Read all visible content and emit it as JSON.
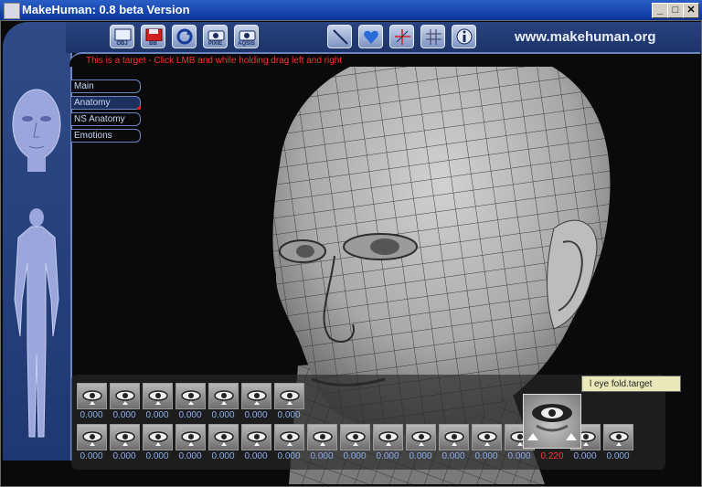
{
  "window": {
    "title": "MakeHuman: 0.8 beta Version",
    "minimize": "_",
    "maximize": "□",
    "close": "✕"
  },
  "toolbar": {
    "buttons": [
      {
        "name": "export-obj",
        "label": "OBJ",
        "icon": "obj-icon"
      },
      {
        "name": "save",
        "label": "BB",
        "icon": "floppy-icon"
      },
      {
        "name": "refresh",
        "label": "",
        "icon": "refresh-icon"
      },
      {
        "name": "render-pixie",
        "label": "PIXIE",
        "icon": "camera-icon"
      },
      {
        "name": "render-aqsis",
        "label": "AQSIS",
        "icon": "camera-icon"
      },
      {
        "name": "tool-line",
        "label": "",
        "icon": "line-icon"
      },
      {
        "name": "tool-shape",
        "label": "",
        "icon": "heart-icon"
      },
      {
        "name": "tool-axes",
        "label": "",
        "icon": "axes-icon"
      },
      {
        "name": "tool-grid",
        "label": "",
        "icon": "grid-icon"
      },
      {
        "name": "info",
        "label": "",
        "icon": "info-icon"
      }
    ],
    "url": "www.makehuman.org"
  },
  "hint": "This is a target - Click LMB and while holding drag left and right",
  "menu": {
    "items": [
      {
        "label": "Main",
        "active": false
      },
      {
        "label": "Anatomy",
        "active": true
      },
      {
        "label": "NS Anatomy",
        "active": false
      },
      {
        "label": "Emotions",
        "active": false
      }
    ]
  },
  "tooltip": "l eye fold.target",
  "targets": {
    "row1": [
      "0.000",
      "0.000",
      "0.000",
      "0.000",
      "0.000",
      "0.000",
      "0.000"
    ],
    "row2": [
      "0.000",
      "0.000",
      "0.000",
      "0.000",
      "0.000",
      "0.000",
      "0.000",
      "0.000",
      "0.000",
      "0.000",
      "0.000",
      "0.000",
      "0.000",
      "0.000",
      "0.220",
      "0.000",
      "0.000"
    ],
    "selected_value": "0.220"
  },
  "colors": {
    "panel": "#24407a",
    "value": "#8fb0ea",
    "hint": "#ff3030",
    "selected_value": "#ff3a3a"
  }
}
